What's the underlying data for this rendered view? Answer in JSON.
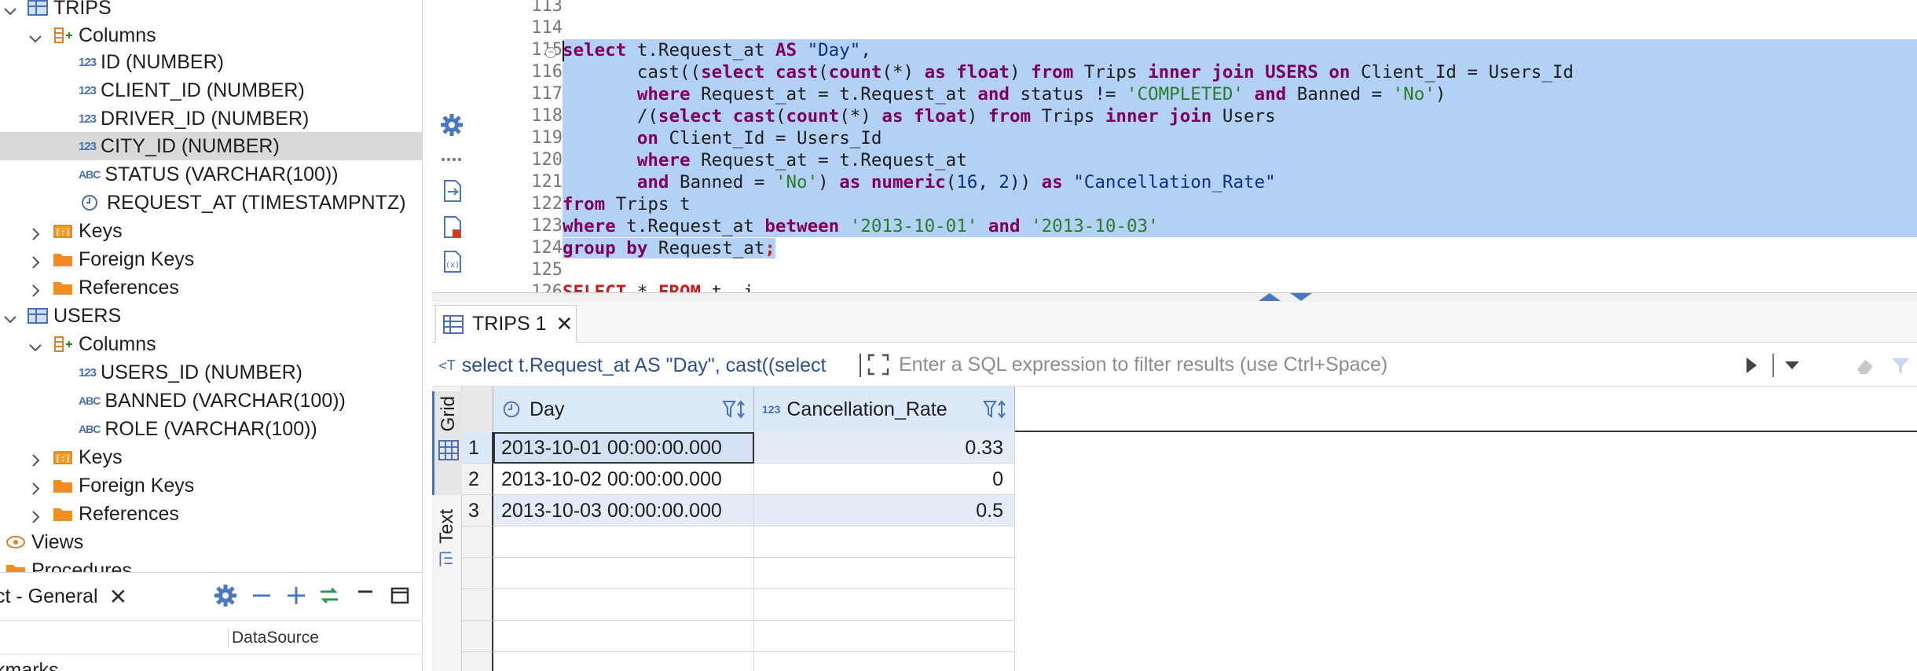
{
  "navigator": {
    "items": [
      {
        "label": "TRIPS",
        "kind": "table"
      },
      {
        "label": "Columns",
        "kind": "folder-columns"
      },
      {
        "label": "ID (NUMBER)",
        "kind": "num"
      },
      {
        "label": "CLIENT_ID (NUMBER)",
        "kind": "num"
      },
      {
        "label": "DRIVER_ID (NUMBER)",
        "kind": "num"
      },
      {
        "label": "CITY_ID (NUMBER)",
        "kind": "num"
      },
      {
        "label": "STATUS (VARCHAR(100))",
        "kind": "abc"
      },
      {
        "label": "REQUEST_AT (TIMESTAMPNTZ)",
        "kind": "clock"
      },
      {
        "label": "Keys",
        "kind": "keys"
      },
      {
        "label": "Foreign Keys",
        "kind": "folder"
      },
      {
        "label": "References",
        "kind": "folder"
      },
      {
        "label": "USERS",
        "kind": "table"
      },
      {
        "label": "Columns",
        "kind": "folder-columns"
      },
      {
        "label": "USERS_ID (NUMBER)",
        "kind": "num"
      },
      {
        "label": "BANNED (VARCHAR(100))",
        "kind": "abc"
      },
      {
        "label": "ROLE (VARCHAR(100))",
        "kind": "abc"
      },
      {
        "label": "Keys",
        "kind": "keys"
      },
      {
        "label": "Foreign Keys",
        "kind": "folder"
      },
      {
        "label": "References",
        "kind": "folder"
      },
      {
        "label": "Views",
        "kind": "views"
      },
      {
        "label": "Procedures",
        "kind": "procedures"
      }
    ],
    "num_badge": "123",
    "abc_badge": "ABC"
  },
  "project_panel": {
    "tab_label": "ct - General",
    "column_header": "DataSource",
    "first_row": "kmarks"
  },
  "editor": {
    "line_numbers": [
      "113",
      "114",
      "115",
      "116",
      "117",
      "118",
      "119",
      "120",
      "121",
      "122",
      "123",
      "124",
      "125",
      "126"
    ],
    "line_115": {
      "kw1": "select",
      "t1": " t.Request_at ",
      "kw2": "AS",
      "sp": " ",
      "dq": "\"Day\"",
      "end": ","
    },
    "line_116": {
      "pad": "       ",
      "t1": "cast((",
      "kw1": "select",
      "sp1": " ",
      "kw2": "cast",
      "t2": "(",
      "kw3": "count",
      "t3": "(*) ",
      "kw4": "as",
      "sp2": " ",
      "kw5": "float",
      "t4": ") ",
      "kw6": "from",
      "t5": " Trips ",
      "kw7": "inner join",
      "sp3": " ",
      "kw8": "USERS",
      "sp4": " ",
      "kw9": "on",
      "t6": " Client_Id = Users_Id"
    },
    "line_117": {
      "pad": "       ",
      "kw1": "where",
      "t1": " Request_at = t.Request_at ",
      "kw2": "and",
      "t2": " status != ",
      "s1": "'COMPLETED'",
      "sp": " ",
      "kw3": "and",
      "t3": " Banned = ",
      "s2": "'No'",
      "t4": ")"
    },
    "line_118": {
      "pad": "       ",
      "t1": "/(",
      "kw1": "select",
      "sp1": " ",
      "kw2": "cast",
      "t2": "(",
      "kw3": "count",
      "t3": "(*) ",
      "kw4": "as",
      "sp2": " ",
      "kw5": "float",
      "t4": ") ",
      "kw6": "from",
      "t5": " Trips ",
      "kw7": "inner join",
      "t6": " Users"
    },
    "line_119": {
      "pad": "       ",
      "kw1": "on",
      "t1": " Client_Id = Users_Id"
    },
    "line_120": {
      "pad": "       ",
      "kw1": "where",
      "t1": " Request_at = t.Request_at"
    },
    "line_121": {
      "pad": "       ",
      "kw1": "and",
      "t1": " Banned = ",
      "s1": "'No'",
      "t2": ") ",
      "kw2": "as",
      "sp1": " ",
      "kw3": "numeric",
      "t3": "(",
      "n1": "16",
      "t4": ", ",
      "n2": "2",
      "t5": ")) ",
      "kw4": "as",
      "sp2": " ",
      "dq": "\"Cancellation_Rate\""
    },
    "line_122": {
      "kw1": "from",
      "t1": " Trips t"
    },
    "line_123": {
      "kw1": "where",
      "t1": " t.Request_at ",
      "kw2": "between",
      "sp1": " ",
      "s1": "'2013-10-01'",
      "sp2": " ",
      "kw3": "and",
      "sp3": " ",
      "s2": "'2013-10-03'"
    },
    "line_124": {
      "kw1": "group by",
      "t1": " Request_at",
      "semi": ";"
    },
    "line_126": {
      "kw1": "SELECT",
      "t1": " * ",
      "kw2": "FROM",
      "t2": " t  i"
    }
  },
  "results": {
    "tab_label": "TRIPS 1",
    "query_preview": "select t.Request_at AS \"Day\", cast((select",
    "filter_placeholder": "Enter a SQL expression to filter results (use Ctrl+Space)",
    "vtabs": [
      "Grid",
      "Text"
    ],
    "columns": [
      {
        "label": "Day",
        "icon": "clock-icon"
      },
      {
        "label": "Cancellation_Rate",
        "icon": "number-icon",
        "badge": "123"
      }
    ],
    "rows": [
      {
        "num": "1",
        "day": "2013-10-01 00:00:00.000",
        "rate": "0.33"
      },
      {
        "num": "2",
        "day": "2013-10-02 00:00:00.000",
        "rate": "0"
      },
      {
        "num": "3",
        "day": "2013-10-03 00:00:00.000",
        "rate": "0.5"
      }
    ]
  },
  "colors": {
    "selection": "#b3d0f5",
    "keyword": "#7f0055",
    "string": "#2a7d2a",
    "accent": "#4a70b8"
  }
}
